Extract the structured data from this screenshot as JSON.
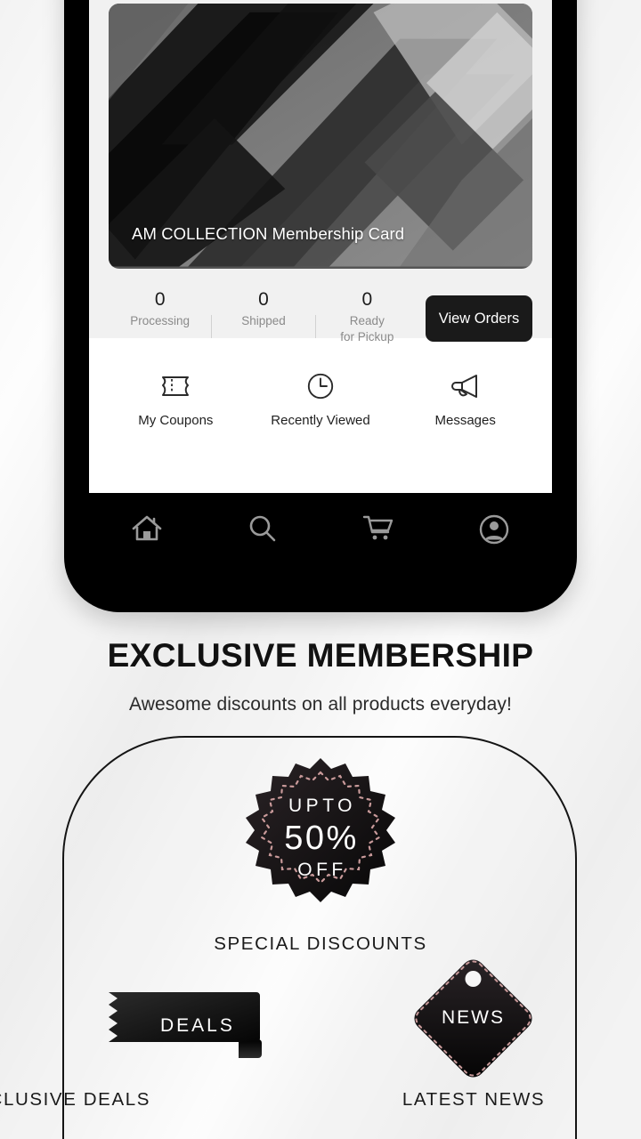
{
  "phone": {
    "membership_card": {
      "label": "AM COLLECTION Membership Card"
    },
    "order_stats": [
      {
        "count": "0",
        "label": "Processing"
      },
      {
        "count": "0",
        "label": "Shipped"
      },
      {
        "count": "0",
        "label": "Ready\nfor Pickup"
      }
    ],
    "view_orders_label": "View Orders",
    "quick_actions": [
      {
        "icon": "ticket-icon",
        "label": "My Coupons"
      },
      {
        "icon": "clock-icon",
        "label": "Recently Viewed"
      },
      {
        "icon": "megaphone-icon",
        "label": "Messages"
      }
    ],
    "bottom_nav": [
      {
        "icon": "home-icon",
        "name": "home"
      },
      {
        "icon": "search-icon",
        "name": "search"
      },
      {
        "icon": "cart-icon",
        "name": "cart"
      },
      {
        "icon": "account-icon",
        "name": "account"
      }
    ]
  },
  "promo": {
    "title": "EXCLUSIVE MEMBERSHIP",
    "subtitle": "Awesome discounts on all products everyday!",
    "seal": {
      "line1": "UPTO",
      "line2": "50%",
      "line3": "OFF"
    },
    "categories": [
      {
        "caption": "SPECIAL DISCOUNTS",
        "badge_text": ""
      },
      {
        "caption": "EXCLUSIVE DEALS",
        "badge_text": "DEALS"
      },
      {
        "caption": "LATEST NEWS",
        "badge_text": "NEWS"
      }
    ]
  },
  "colors": {
    "background": "#f3f3f3",
    "ink": "#111111",
    "panel": "#f1f1f1",
    "accent_dashed": "#c99a9a",
    "nav_icon": "#9a9a9a"
  }
}
